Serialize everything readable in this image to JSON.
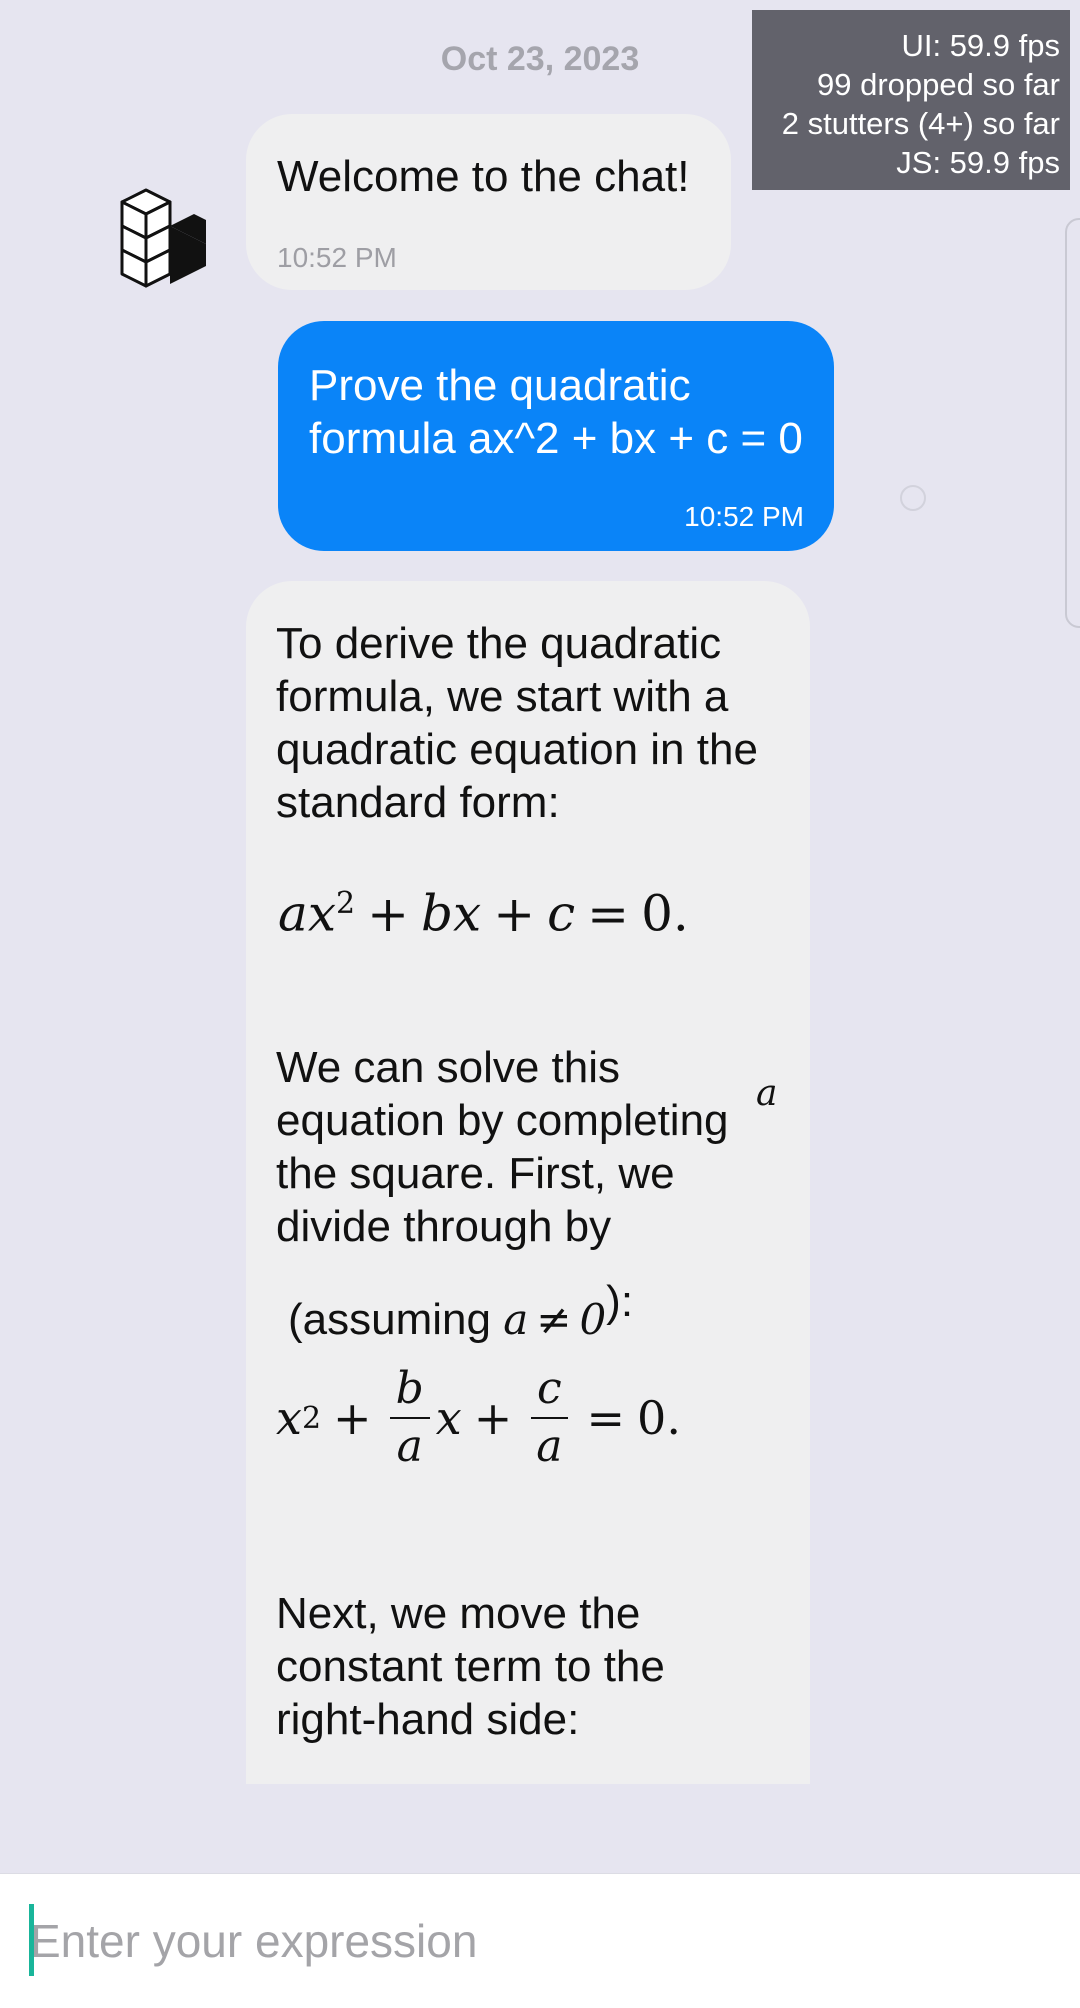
{
  "chat": {
    "date": "Oct 23, 2023",
    "welcome": {
      "text": "Welcome to the chat!",
      "time": "10:52 PM"
    },
    "user_message": {
      "text": "Prove the quadratic formula ax^2 + bx + c = 0",
      "time": "10:52 PM"
    },
    "answer": {
      "p1": "To derive the quadratic formula, we start with a quadratic equation in the standard form:",
      "eq1": {
        "a": "a",
        "x": "x",
        "exp": "2",
        "plus1": "+",
        "b": "b",
        "x2": "x",
        "plus2": "+",
        "c": "c",
        "eq": "=",
        "zero": "0."
      },
      "p2": "We can solve this equation by completing the square. First, we divide through by",
      "floating_var": "a",
      "p3": {
        "open": "(assuming ",
        "a": "a",
        "neq": "≠",
        "zero": "0",
        "close": "):"
      },
      "eq2": {
        "x": "x",
        "exp": "2",
        "plus1": "+",
        "b": "b",
        "a1": "a",
        "x2": "x",
        "plus2": "+",
        "c": "c",
        "a2": "a",
        "eq": "=",
        "zero": "0."
      },
      "p4": "Next, we move the constant term to the right-hand side:"
    }
  },
  "perf_monitor": {
    "ui": "UI: 59.9 fps",
    "dropped": "99 dropped so far",
    "stutters": "2 stutters (4+) so far",
    "js": "JS: 59.9 fps"
  },
  "composer": {
    "placeholder": "Enter your expression",
    "value": ""
  },
  "icons": {
    "avatar": "isometric-cube-avatar-icon",
    "read_receipt": "read-receipt-icon"
  },
  "colors": {
    "background": "#e6e5f0",
    "incoming_bubble": "#efeff0",
    "outgoing_bubble": "#0a84f8",
    "caret": "#19b59a"
  }
}
